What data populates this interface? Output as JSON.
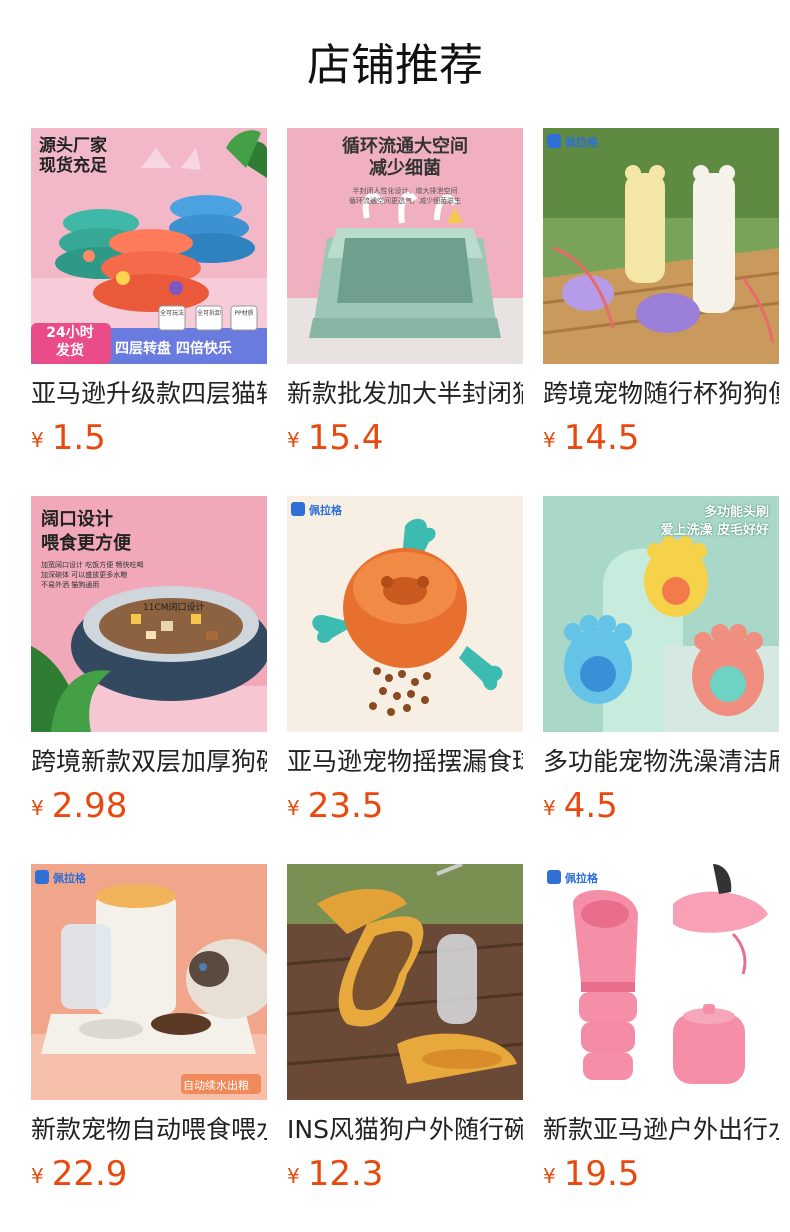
{
  "page": {
    "title": "店铺推荐"
  },
  "products": [
    {
      "name": "亚马逊升级款四层猫转盘",
      "currency": "¥",
      "price": "1.5",
      "image": {
        "bg": "#f2b7c8",
        "texts": [
          "源头厂家",
          "现货充足",
          "24小时",
          "发货",
          "四层转盘 四倍快乐",
          "全可玩法",
          "全可拆卸",
          "PP材质"
        ]
      }
    },
    {
      "name": "新款批发加大半封闭猫砂盆",
      "currency": "¥",
      "price": "15.4",
      "image": {
        "bg": "#f0aebf",
        "texts": [
          "循环流通大空间",
          "减少细菌",
          "半封闭人性化设计，增大排泄空间",
          "循环流通空间更透气，减少细菌滋生"
        ]
      }
    },
    {
      "name": "跨境宠物随行杯狗狗便携水杯",
      "currency": "¥",
      "price": "14.5",
      "image": {
        "bg": "#6f9a4c",
        "texts": [
          "佩拉格"
        ]
      }
    },
    {
      "name": "跨境新款双层加厚狗碗",
      "currency": "¥",
      "price": "2.98",
      "image": {
        "bg": "#f1a8b8",
        "texts": [
          "阔口设计",
          "喂食更方便",
          "加宽阔口设计 吃饭方便 畅快吃喝",
          "加深碗体 可以盛放更多水粮",
          "不易外洒 猫狗通用",
          "11CM阔口设计"
        ]
      }
    },
    {
      "name": "亚马逊宠物摇摆漏食球",
      "currency": "¥",
      "price": "23.5",
      "image": {
        "bg": "#f6ede3",
        "texts": [
          "佩拉格"
        ]
      }
    },
    {
      "name": "多功能宠物洗澡清洁刷",
      "currency": "¥",
      "price": "4.5",
      "image": {
        "bg": "#a8d7c6",
        "texts": [
          "多功能头刷",
          "爱上洗澡 皮毛好好"
        ]
      }
    },
    {
      "name": "新款宠物自动喂食喂水器",
      "currency": "¥",
      "price": "22.9",
      "image": {
        "bg": "#f2a98f",
        "texts": [
          "佩拉格",
          "自动续水出粮"
        ]
      }
    },
    {
      "name": "INS风猫狗户外随行碗",
      "currency": "¥",
      "price": "12.3",
      "image": {
        "bg": "#6a4a36",
        "texts": []
      }
    },
    {
      "name": "新款亚马逊户外出行水杯",
      "currency": "¥",
      "price": "19.5",
      "image": {
        "bg": "#ffffff",
        "texts": [
          "佩拉格"
        ]
      }
    }
  ]
}
